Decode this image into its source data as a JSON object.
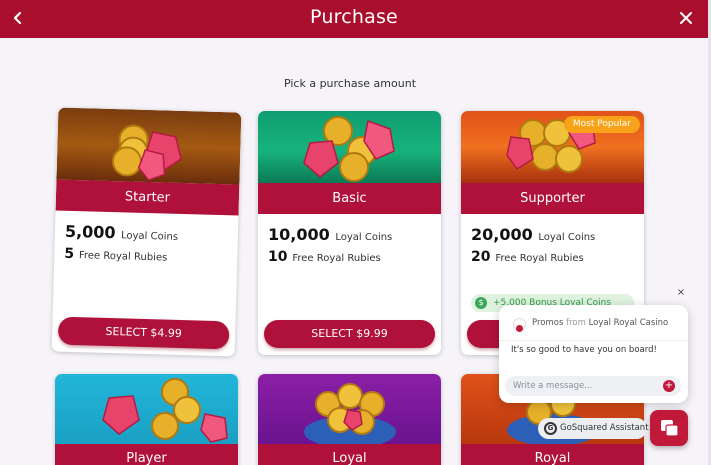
{
  "header": {
    "title": "Purchase"
  },
  "subtitle": "Pick a purchase amount",
  "cards": [
    {
      "name": "Starter",
      "coins": "5,000",
      "coins_label": "Loyal Coins",
      "rubies": "5",
      "rubies_label": "Free Royal Rubies",
      "button": "SELECT $4.99"
    },
    {
      "name": "Basic",
      "coins": "10,000",
      "coins_label": "Loyal Coins",
      "rubies": "10",
      "rubies_label": "Free Royal Rubies",
      "button": "SELECT $9.99"
    },
    {
      "name": "Supporter",
      "coins": "20,000",
      "coins_label": "Loyal Coins",
      "rubies": "20",
      "rubies_label": "Free Royal Rubies",
      "badge": "Most Popular",
      "bonus": "+5,000 Bonus Loyal Coins"
    }
  ],
  "more_cards": [
    {
      "name": "Player"
    },
    {
      "name": "Loyal"
    },
    {
      "name": "Royal"
    }
  ],
  "chat": {
    "from_label": "Promos",
    "from_word": "from",
    "from_org": "Loyal Royal Casino",
    "message": "It's so good to have you on board!",
    "input_placeholder": "Write a message...",
    "assistant_label": "GoSquared Assistant"
  },
  "colors": {
    "header": "#a90f2c",
    "band": "#b0113a",
    "badge": "#f8a21a",
    "bonus_green": "#2f9e44"
  }
}
